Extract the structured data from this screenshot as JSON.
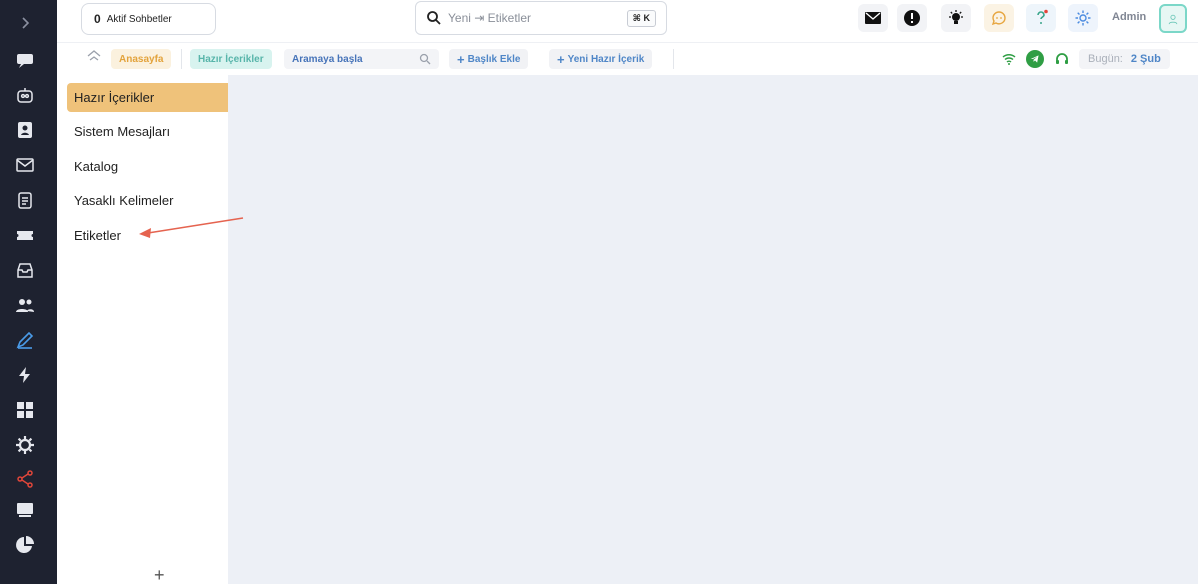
{
  "topbar": {
    "active_count": "0",
    "active_label": "Aktif Sohbetler",
    "search_placeholder": "Yeni ⇥ Etiketler",
    "shortcut": "⌘ K",
    "user": "Admin"
  },
  "subbar": {
    "home": "Anasayfa",
    "current": "Hazır İçerikler",
    "search_placeholder": "Aramaya başla",
    "add_title": "Başlık Ekle",
    "new_content": "Yeni Hazır İçerik",
    "today_label": "Bugün:",
    "today_value": "2 Şub"
  },
  "menu": {
    "items": [
      "Hazır İçerikler",
      "Sistem Mesajları",
      "Katalog",
      "Yasaklı Kelimeler",
      "Etiketler"
    ],
    "active_index": 0,
    "add_symbol": "+"
  },
  "colors": {
    "rail": "#1e2230",
    "active_item": "#efc27a",
    "arrow": "#e5634f"
  }
}
